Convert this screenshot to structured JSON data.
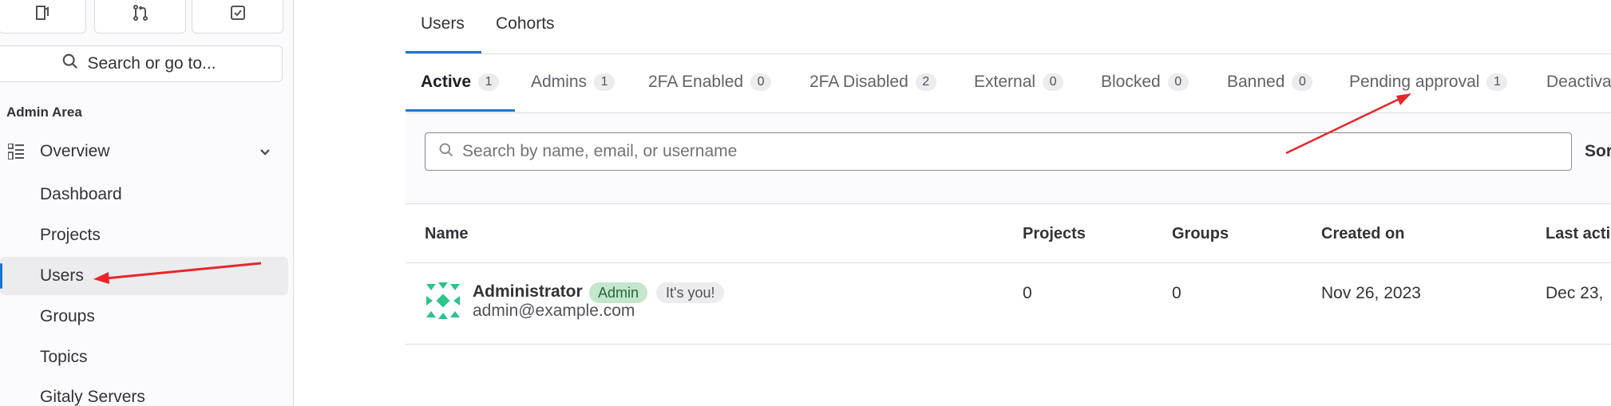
{
  "sidebar": {
    "top_icons": [
      "issues-icon",
      "merge-request-icon",
      "todo-icon"
    ],
    "search_label": "Search or go to...",
    "section_title": "Admin Area",
    "overview_label": "Overview",
    "items": [
      {
        "label": "Dashboard"
      },
      {
        "label": "Projects"
      },
      {
        "label": "Users"
      },
      {
        "label": "Groups"
      },
      {
        "label": "Topics"
      },
      {
        "label": "Gitaly Servers"
      }
    ],
    "active_item": "Users"
  },
  "top_tabs": [
    {
      "label": "Users",
      "active": true
    },
    {
      "label": "Cohorts",
      "active": false
    }
  ],
  "filter_tabs": [
    {
      "label": "Active",
      "count": "1",
      "active": true
    },
    {
      "label": "Admins",
      "count": "1"
    },
    {
      "label": "2FA Enabled",
      "count": "0"
    },
    {
      "label": "2FA Disabled",
      "count": "2"
    },
    {
      "label": "External",
      "count": "0"
    },
    {
      "label": "Blocked",
      "count": "0"
    },
    {
      "label": "Banned",
      "count": "0"
    },
    {
      "label": "Pending approval",
      "count": "1"
    },
    {
      "label": "Deactiva",
      "count": ""
    }
  ],
  "search": {
    "placeholder": "Search by name, email, or username",
    "sort_label": "Sor"
  },
  "table": {
    "headers": {
      "name": "Name",
      "projects": "Projects",
      "groups": "Groups",
      "created": "Created on",
      "last_activity": "Last acti"
    },
    "rows": [
      {
        "name": "Administrator",
        "admin_badge": "Admin",
        "you_badge": "It's you!",
        "email": "admin@example.com",
        "projects": "0",
        "groups": "0",
        "created": "Nov 26, 2023",
        "last_activity": "Dec 23,"
      }
    ]
  },
  "colors": {
    "accent": "#1f75cb",
    "annotation_arrow": "#e8262a",
    "admin_badge_bg": "#c3e6cd"
  }
}
